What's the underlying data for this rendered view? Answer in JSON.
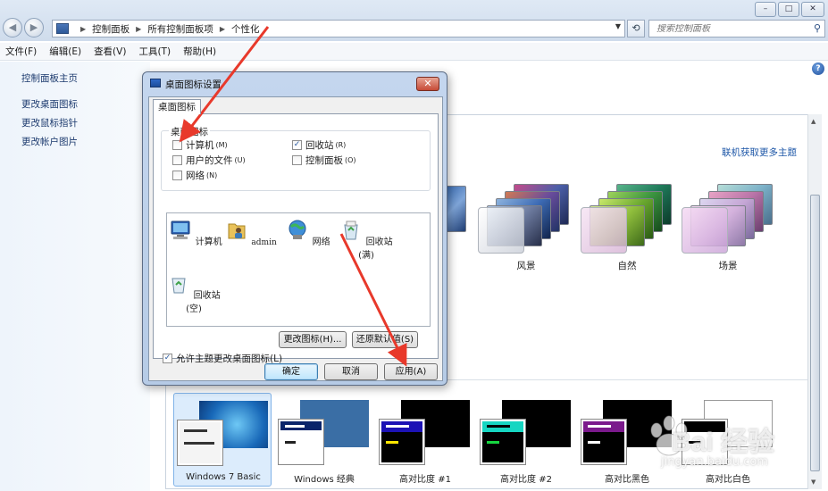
{
  "window": {
    "minimize": "▭",
    "maximize": "□",
    "close": "✕"
  },
  "address": {
    "breadcrumbs": [
      "控制面板",
      "所有控制面板项",
      "个性化"
    ],
    "search_placeholder": "搜索控制面板"
  },
  "menu": [
    "文件(F)",
    "编辑(E)",
    "查看(V)",
    "工具(T)",
    "帮助(H)"
  ],
  "sidebar": {
    "items": [
      "控制面板主页",
      "更改桌面图标",
      "更改鼠标指针",
      "更改帐户图片"
    ]
  },
  "themes": {
    "online_link": "联机获取更多主题",
    "aero": [
      {
        "label": "风景"
      },
      {
        "label": "自然"
      },
      {
        "label": "场景"
      }
    ],
    "basic": [
      {
        "label": "Windows 7 Basic",
        "selected": true
      },
      {
        "label": "Windows 经典"
      },
      {
        "label": "高对比度 #1"
      },
      {
        "label": "高对比度 #2"
      },
      {
        "label": "高对比黑色"
      },
      {
        "label": "高对比白色"
      }
    ]
  },
  "dialog": {
    "title": "桌面图标设置",
    "close": "✕",
    "tab": "桌面图标",
    "group_label": "桌面图标",
    "checkboxes": [
      {
        "label": "计算机",
        "key": "(M)",
        "checked": false
      },
      {
        "label": "回收站",
        "key": "(R)",
        "checked": true
      },
      {
        "label": "用户的文件",
        "key": "(U)",
        "checked": false
      },
      {
        "label": "控制面板",
        "key": "(O)",
        "checked": false
      },
      {
        "label": "网络",
        "key": "(N)",
        "checked": false
      }
    ],
    "icons": [
      {
        "label": "计算机",
        "icon": "computer-icon"
      },
      {
        "label": "admin",
        "icon": "user-folder-icon"
      },
      {
        "label": "网络",
        "icon": "network-icon"
      },
      {
        "label": "回收站(满)",
        "icon": "recycle-bin-full-icon"
      },
      {
        "label": "回收站(空)",
        "icon": "recycle-bin-empty-icon"
      }
    ],
    "change_icon": "更改图标(H)...",
    "restore_default": "还原默认值(S)",
    "allow_themes": "允许主题更改桌面图标(L)",
    "allow_themes_checked": true,
    "ok": "确定",
    "cancel": "取消",
    "apply": "应用(A)"
  },
  "watermark": {
    "brand": "Bai 经验",
    "url": "jingyan.baidu.com"
  },
  "colors": {
    "link": "#1f58a8",
    "arrow": "#e8392b",
    "dialog_frame": "#b6cbe6"
  }
}
